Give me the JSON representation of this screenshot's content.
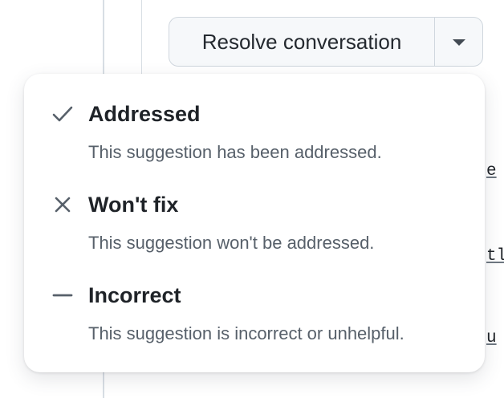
{
  "toolbar": {
    "resolve_label": "Resolve conversation",
    "dropdown_icon": "triangle-down-icon"
  },
  "background_code": {
    "fragments": [
      "e",
      "tlc",
      "u"
    ]
  },
  "menu": {
    "items": [
      {
        "icon": "check-icon",
        "title": "Addressed",
        "description": "This suggestion has been addressed."
      },
      {
        "icon": "x-icon",
        "title": "Won't fix",
        "description": "This suggestion won't be addressed."
      },
      {
        "icon": "dash-icon",
        "title": "Incorrect",
        "description": "This suggestion is incorrect or unhelpful."
      }
    ]
  },
  "colors": {
    "title_text": "#1f2328",
    "description_text": "#57606a",
    "icon": "#57606a",
    "button_bg": "#f6f8fa",
    "border": "#d0d7de"
  }
}
